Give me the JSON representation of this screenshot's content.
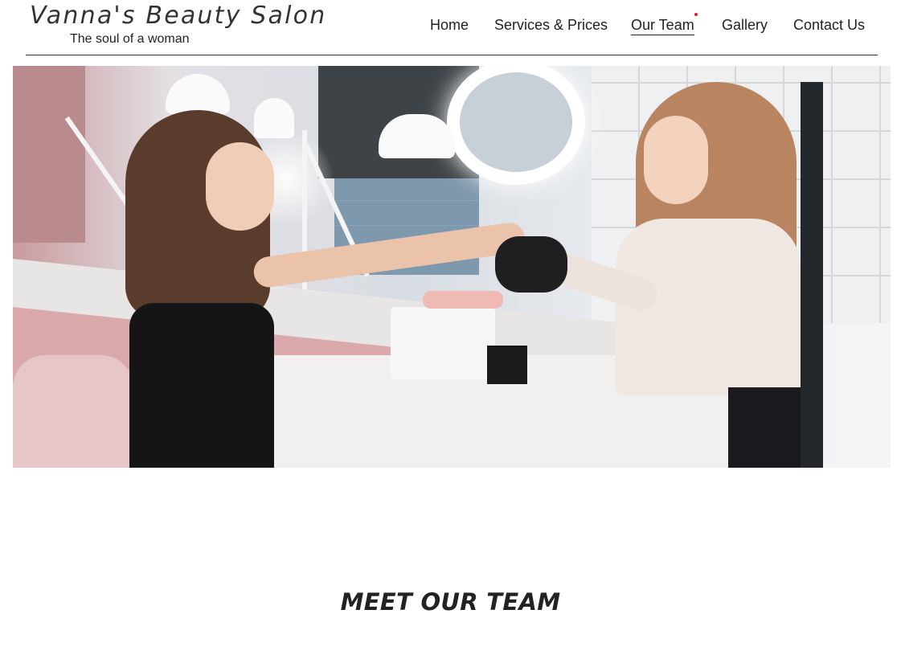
{
  "brand": {
    "title": "Vanna's Beauty Salon",
    "tagline": "The soul of a woman"
  },
  "nav": {
    "items": [
      {
        "label": "Home",
        "active": false
      },
      {
        "label": "Services & Prices",
        "active": false
      },
      {
        "label": "Our Team",
        "active": true
      },
      {
        "label": "Gallery",
        "active": false
      },
      {
        "label": "Contact Us",
        "active": false
      }
    ],
    "active_indicator_color": "#e02020"
  },
  "hero": {
    "image": "salon-manicure-photo"
  },
  "section": {
    "title": "MEET OUR TEAM"
  }
}
